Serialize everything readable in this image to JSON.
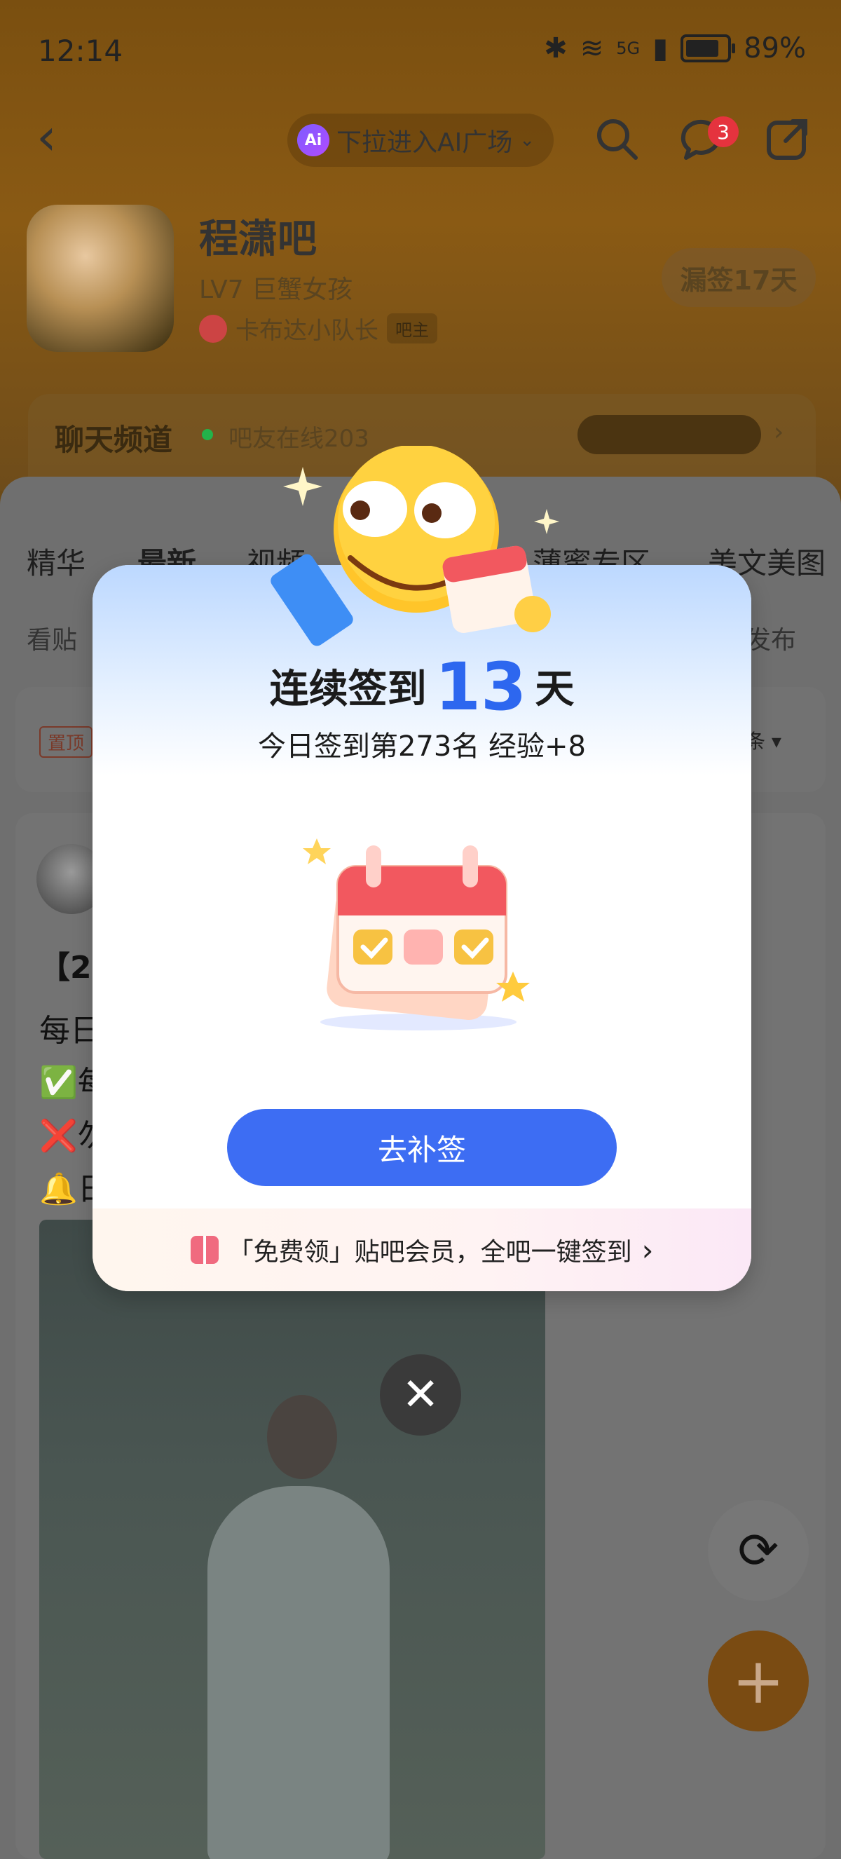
{
  "status_bar": {
    "time": "12:14",
    "battery": "89%",
    "network": "5G"
  },
  "header": {
    "ai_entry": "下拉进入AI广场",
    "message_badge": "3",
    "forum_name": "程潇吧",
    "forum_level": "LV7 巨蟹女孩",
    "owner_name": "卡布达小队长",
    "owner_tag": "吧主",
    "missed_signin": "漏签17天"
  },
  "chat_channel": {
    "title": "聊天频道",
    "online_text": "吧友在线203"
  },
  "tabs": [
    {
      "label": "精华"
    },
    {
      "label": "最新"
    },
    {
      "label": "视频"
    },
    {
      "label": "薄蜜专区"
    },
    {
      "label": "美文美图"
    }
  ],
  "sub_row": {
    "left": "看贴",
    "right": "发布"
  },
  "pinned": {
    "tag": "置顶",
    "sort_label": "条"
  },
  "post": {
    "lines": [
      "【2",
      "每日",
      "✅每",
      "❌勿",
      "🔔日"
    ]
  },
  "modal": {
    "streak_prefix": "连续签到",
    "streak_days": "13",
    "streak_suffix": "天",
    "rank_line": "今日签到第273名 经验+8",
    "makeup_button": "去补签",
    "promo_text": "「免费领」贴吧会员，全吧一键签到",
    "promo_arrow": "›"
  },
  "icons": {
    "back": "back-chevron-icon",
    "search": "search-icon",
    "message": "message-icon",
    "share": "share-icon",
    "refresh": "refresh-icon",
    "compose": "plus-icon",
    "close": "close-icon",
    "gift": "gift-icon"
  },
  "colors": {
    "accent_blue": "#3d6df3",
    "streak_number": "#2d67ef",
    "badge_red": "#e5333e",
    "online_green": "#23b34a"
  }
}
